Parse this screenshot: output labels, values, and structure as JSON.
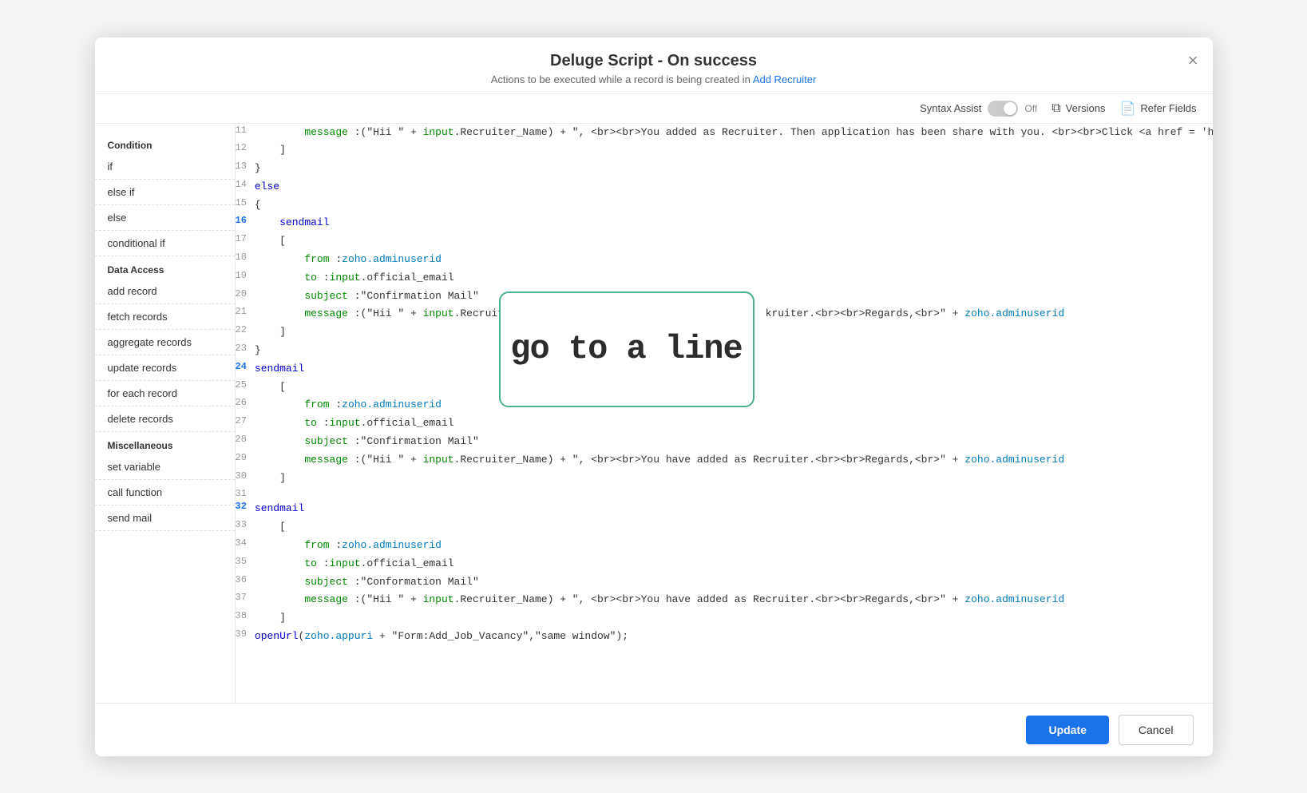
{
  "modal": {
    "title": "Deluge Script - On success",
    "subtitle": "Actions to be executed while a record is being created in",
    "subtitle_link": "Add Recruiter",
    "close_label": "×"
  },
  "toolbar": {
    "syntax_assist_label": "Syntax Assist",
    "syntax_toggle_label": "Off",
    "versions_label": "Versions",
    "refer_fields_label": "Refer Fields"
  },
  "sidebar": {
    "condition_title": "Condition",
    "condition_items": [
      "if",
      "else if",
      "else",
      "conditional if"
    ],
    "data_access_title": "Data Access",
    "data_access_items": [
      "add record",
      "fetch records",
      "aggregate records",
      "update records",
      "for each record",
      "delete records"
    ],
    "misc_title": "Miscellaneous",
    "misc_items": [
      "set variable",
      "call function",
      "send mail"
    ]
  },
  "code_lines": [
    {
      "num": "11",
      "highlight": false,
      "code": "        message :(\"Hii \" + input.Recruiter_Name) + \", <br><br>You added as Recruiter. Then application has been share with you. <br><br>Click <a href = 'https://app.zohocreator.com/\" + zoho.appuri + \"\">here</a> to access the application<br><br>Regards,<br>\" + zoho.adminuserid"
    },
    {
      "num": "12",
      "highlight": false,
      "code": "    ]"
    },
    {
      "num": "13",
      "highlight": false,
      "code": "}"
    },
    {
      "num": "14",
      "highlight": false,
      "code": "else"
    },
    {
      "num": "15",
      "highlight": false,
      "code": "{"
    },
    {
      "num": "16",
      "highlight": true,
      "code": "    sendmail"
    },
    {
      "num": "17",
      "highlight": false,
      "code": "    ["
    },
    {
      "num": "18",
      "highlight": false,
      "code": "        from :zoho.adminuserid"
    },
    {
      "num": "19",
      "highlight": false,
      "code": "        to :input.official_email"
    },
    {
      "num": "20",
      "highlight": false,
      "code": "        subject :\"Confirmation Mail\""
    },
    {
      "num": "21",
      "highlight": false,
      "code": "        message :(\"Hii \" + input.Recruit                                          kruiter.<br><br>Regards,<br>\" + zoho.adminuserid"
    },
    {
      "num": "22",
      "highlight": false,
      "code": "    ]"
    },
    {
      "num": "23",
      "highlight": false,
      "code": "}"
    },
    {
      "num": "24",
      "highlight": true,
      "code": "sendmail"
    },
    {
      "num": "25",
      "highlight": false,
      "code": "    ["
    },
    {
      "num": "26",
      "highlight": false,
      "code": "        from :zoho.adminuserid"
    },
    {
      "num": "27",
      "highlight": false,
      "code": "        to :input.official_email"
    },
    {
      "num": "28",
      "highlight": false,
      "code": "        subject :\"Confirmation Mail\""
    },
    {
      "num": "29",
      "highlight": false,
      "code": "        message :(\"Hii \" + input.Recruiter_Name) + \", <br><br>You have added as Recruiter.<br><br>Regards,<br>\" + zoho.adminuserid"
    },
    {
      "num": "30",
      "highlight": false,
      "code": "    ]"
    },
    {
      "num": "31",
      "highlight": false,
      "code": ""
    },
    {
      "num": "32",
      "highlight": true,
      "code": "sendmail"
    },
    {
      "num": "33",
      "highlight": false,
      "code": "    ["
    },
    {
      "num": "34",
      "highlight": false,
      "code": "        from :zoho.adminuserid"
    },
    {
      "num": "35",
      "highlight": false,
      "code": "        to :input.official_email"
    },
    {
      "num": "36",
      "highlight": false,
      "code": "        subject :\"Conformation Mail\""
    },
    {
      "num": "37",
      "highlight": false,
      "code": "        message :(\"Hii \" + input.Recruiter_Name) + \", <br><br>You have added as Recruiter.<br><br>Regards,<br>\" + zoho.adminuserid"
    },
    {
      "num": "38",
      "highlight": false,
      "code": "    ]"
    },
    {
      "num": "39",
      "highlight": false,
      "code": "openUrl(zoho.appuri + \"Form:Add_Job_Vacancy\",\"same window\");"
    }
  ],
  "overlay": {
    "text": "go to a line"
  },
  "footer": {
    "update_label": "Update",
    "cancel_label": "Cancel"
  }
}
